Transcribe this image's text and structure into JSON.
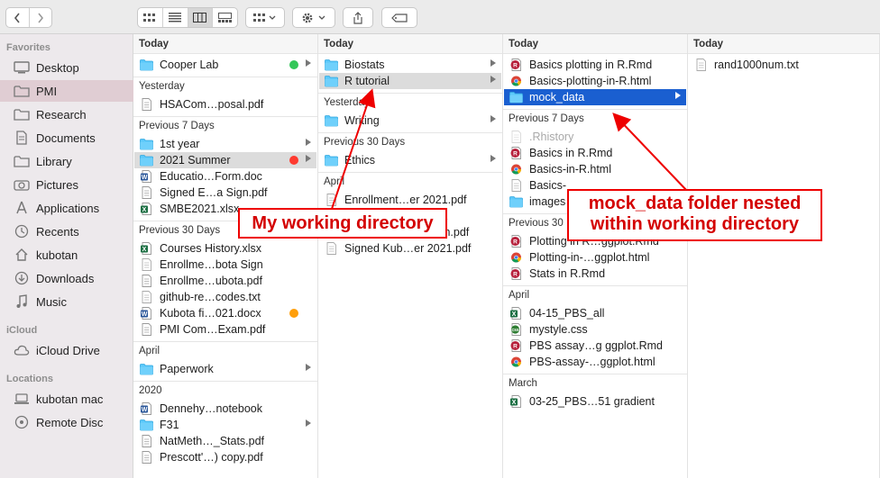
{
  "sidebar": {
    "favorites_label": "Favorites",
    "favorites": [
      {
        "label": "Desktop",
        "icon": "desktop-icon"
      },
      {
        "label": "PMI",
        "icon": "folder-icon"
      },
      {
        "label": "Research",
        "icon": "folder-icon"
      },
      {
        "label": "Documents",
        "icon": "document-icon"
      },
      {
        "label": "Library",
        "icon": "folder-icon"
      },
      {
        "label": "Pictures",
        "icon": "camera-icon"
      },
      {
        "label": "Applications",
        "icon": "applications-icon"
      },
      {
        "label": "Recents",
        "icon": "clock-icon"
      },
      {
        "label": "kubotan",
        "icon": "home-icon"
      },
      {
        "label": "Downloads",
        "icon": "download-icon"
      },
      {
        "label": "Music",
        "icon": "music-icon"
      }
    ],
    "icloud_label": "iCloud",
    "icloud": [
      {
        "label": "iCloud Drive",
        "icon": "cloud-icon"
      }
    ],
    "locations_label": "Locations",
    "locations": [
      {
        "label": "kubotan mac",
        "icon": "laptop-icon"
      },
      {
        "label": "Remote Disc",
        "icon": "disc-icon"
      }
    ]
  },
  "columns": [
    {
      "sections": [
        {
          "title": "Today",
          "items": [
            {
              "name": "Cooper Lab",
              "type": "folder",
              "tag": "#34c759",
              "chevron": true
            }
          ]
        },
        {
          "title": "Yesterday",
          "items": [
            {
              "name": "HSACom…posal.pdf",
              "type": "pdf"
            }
          ]
        },
        {
          "title": "Previous 7 Days",
          "items": [
            {
              "name": "1st year",
              "type": "folder",
              "chevron": true
            },
            {
              "name": "2021 Summer",
              "type": "folder",
              "tag": "#ff3b30",
              "chevron": true,
              "selected": true
            },
            {
              "name": "Educatio…Form.doc",
              "type": "word"
            },
            {
              "name": "Signed E…a Sign.pdf",
              "type": "pdf"
            },
            {
              "name": "SMBE2021.xlsx",
              "type": "excel"
            }
          ]
        },
        {
          "title": "Previous 30 Days",
          "items": [
            {
              "name": "Courses History.xlsx",
              "type": "excel"
            },
            {
              "name": "Enrollme…bota Sign",
              "type": "doc"
            },
            {
              "name": "Enrollme…ubota.pdf",
              "type": "pdf"
            },
            {
              "name": "github-re…codes.txt",
              "type": "doc"
            },
            {
              "name": "Kubota fi…021.docx",
              "type": "word",
              "tag": "#ff9f0a"
            },
            {
              "name": "PMI Com…Exam.pdf",
              "type": "pdf"
            }
          ]
        },
        {
          "title": "April",
          "items": [
            {
              "name": "Paperwork",
              "type": "folder",
              "chevron": true
            }
          ]
        },
        {
          "title": "2020",
          "items": [
            {
              "name": "Dennehy…notebook",
              "type": "word"
            },
            {
              "name": "F31",
              "type": "folder",
              "chevron": true
            },
            {
              "name": "NatMeth…_Stats.pdf",
              "type": "pdf"
            },
            {
              "name": "Prescott'…) copy.pdf",
              "type": "pdf"
            }
          ]
        }
      ]
    },
    {
      "sections": [
        {
          "title": "Today",
          "items": [
            {
              "name": "Biostats",
              "type": "folder",
              "chevron": true
            },
            {
              "name": "R tutorial",
              "type": "folder",
              "chevron": true,
              "selected": true
            }
          ]
        },
        {
          "title": "Yesterday",
          "items": [
            {
              "name": "Writing",
              "type": "folder",
              "chevron": true
            }
          ]
        },
        {
          "title": "Previous 30 Days",
          "items": [
            {
              "name": "Ethics",
              "type": "folder",
              "chevron": true
            }
          ]
        },
        {
          "title": "April",
          "items": [
            {
              "name": "Enrollment…er 2021.pdf",
              "type": "doc"
            },
            {
              "name": "Enrollment…er 2021",
              "type": "doc"
            },
            {
              "name": "Kubota St…ent Form.pdf",
              "type": "doc"
            },
            {
              "name": "Signed Kub…er 2021.pdf",
              "type": "doc"
            }
          ]
        }
      ]
    },
    {
      "sections": [
        {
          "title": "Today",
          "items": [
            {
              "name": "Basics plotting in R.Rmd",
              "type": "rmd"
            },
            {
              "name": "Basics-plotting-in-R.html",
              "type": "chrome"
            },
            {
              "name": "mock_data",
              "type": "folder",
              "chevron": true,
              "active": true
            }
          ]
        },
        {
          "title": "Previous 7 Days",
          "items": [
            {
              "name": ".Rhistory",
              "type": "doc",
              "dim": true
            },
            {
              "name": "Basics in R.Rmd",
              "type": "rmd"
            },
            {
              "name": "Basics-in-R.html",
              "type": "chrome"
            },
            {
              "name": "Basics-",
              "type": "doc"
            },
            {
              "name": "images",
              "type": "folder"
            }
          ]
        },
        {
          "title": "Previous 30",
          "items": [
            {
              "name": "Plotting in R…ggplot.Rmd",
              "type": "rmd"
            },
            {
              "name": "Plotting-in-…ggplot.html",
              "type": "chrome"
            },
            {
              "name": "Stats in R.Rmd",
              "type": "rmd"
            }
          ]
        },
        {
          "title": "April",
          "items": [
            {
              "name": "04-15_PBS_all",
              "type": "excel"
            },
            {
              "name": "mystyle.css",
              "type": "css"
            },
            {
              "name": "PBS assay…g ggplot.Rmd",
              "type": "rmd"
            },
            {
              "name": "PBS-assay-…ggplot.html",
              "type": "chrome"
            }
          ]
        },
        {
          "title": "March",
          "items": [
            {
              "name": "03-25_PBS…51 gradient",
              "type": "excel"
            }
          ]
        }
      ]
    },
    {
      "sections": [
        {
          "title": "Today",
          "items": [
            {
              "name": "rand1000num.txt",
              "type": "doc"
            }
          ]
        }
      ]
    }
  ],
  "annotations": {
    "working_directory": "My working directory",
    "mock_data": "mock_data folder nested within working directory"
  },
  "colors": {
    "annotation": "#e00000",
    "selection_active": "#1a5fd0",
    "folder": "#5ac8fa"
  }
}
